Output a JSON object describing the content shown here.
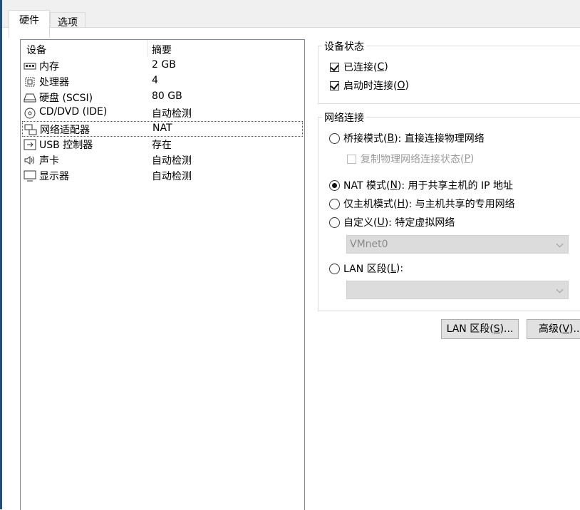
{
  "tabs": [
    {
      "label": "硬件",
      "active": true
    },
    {
      "label": "选项",
      "active": false
    }
  ],
  "device_list": {
    "columns": {
      "device": "设备",
      "summary": "摘要"
    },
    "rows": [
      {
        "icon": "memory-icon",
        "name": "内存",
        "summary": "2 GB"
      },
      {
        "icon": "processor-icon",
        "name": "处理器",
        "summary": "4"
      },
      {
        "icon": "hard-disk-icon",
        "name": "硬盘 (SCSI)",
        "summary": "80 GB"
      },
      {
        "icon": "cd-dvd-icon",
        "name": "CD/DVD (IDE)",
        "summary": "自动检测"
      },
      {
        "icon": "network-adapter-icon",
        "name": "网络适配器",
        "summary": "NAT",
        "selected": true
      },
      {
        "icon": "usb-icon",
        "name": "USB 控制器",
        "summary": "存在"
      },
      {
        "icon": "sound-card-icon",
        "name": "声卡",
        "summary": "自动检测"
      },
      {
        "icon": "display-icon",
        "name": "显示器",
        "summary": "自动检测"
      }
    ]
  },
  "device_status": {
    "title": "设备状态",
    "connected": {
      "text": "已连接(",
      "key": "C",
      "tail": ")",
      "checked": true
    },
    "connect_at_power_on": {
      "text": "启动时连接(",
      "key": "O",
      "tail": ")",
      "checked": true
    }
  },
  "network_connection": {
    "title": "网络连接",
    "bridged": {
      "text": "桥接模式(",
      "key": "B",
      "tail": "): 直接连接物理网络",
      "selected": false
    },
    "replicate": {
      "text": "复制物理网络连接状态(",
      "key": "P",
      "tail": ")",
      "checked": false,
      "disabled": true
    },
    "nat": {
      "text": "NAT 模式(",
      "key": "N",
      "tail": "): 用于共享主机的 IP 地址",
      "selected": true
    },
    "host_only": {
      "text": "仅主机模式(",
      "key": "H",
      "tail": "): 与主机共享的专用网络",
      "selected": false
    },
    "custom": {
      "text": "自定义(",
      "key": "U",
      "tail": "): 特定虚拟网络",
      "selected": false
    },
    "custom_select": {
      "value": "VMnet0",
      "disabled": true
    },
    "lan_segment": {
      "text": "LAN 区段(",
      "key": "L",
      "tail": "):",
      "selected": false
    },
    "lan_select": {
      "value": "",
      "disabled": true
    }
  },
  "buttons": {
    "lan_segments": {
      "text": "LAN 区段(",
      "key": "S",
      "tail": ")..."
    },
    "advanced": {
      "text": "高级(",
      "key": "V",
      "tail": ")..."
    }
  },
  "colors": {
    "window_edge": "#1e4f7a",
    "panel_bg": "#f0f0f0",
    "list_border": "#828790"
  }
}
